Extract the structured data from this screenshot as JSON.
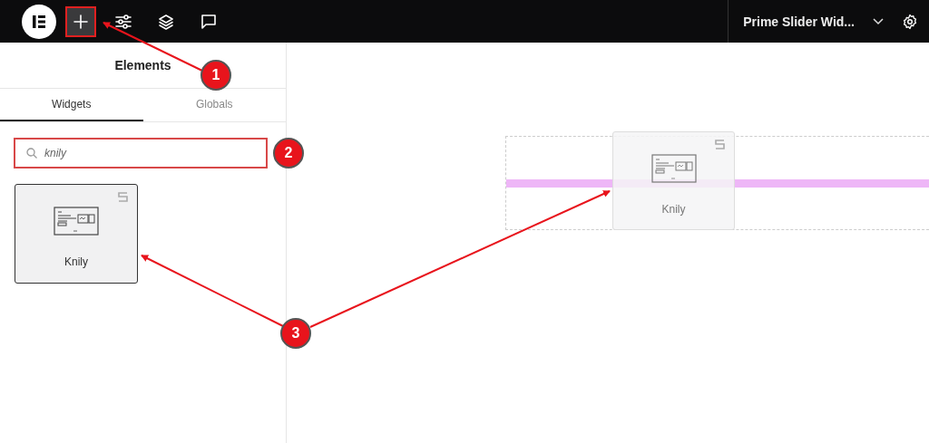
{
  "topbar": {
    "document_title": "Prime Slider Wid...",
    "tools": [
      {
        "kind": "add",
        "selected": true
      },
      {
        "kind": "sliders",
        "selected": false
      },
      {
        "kind": "layers",
        "selected": false
      },
      {
        "kind": "comment",
        "selected": false
      }
    ]
  },
  "sidebar": {
    "title": "Elements",
    "tabs": [
      {
        "label": "Widgets",
        "selected": true
      },
      {
        "label": "Globals",
        "selected": false
      }
    ],
    "search": {
      "value": "knily"
    },
    "widgets": [
      {
        "label": "Knily"
      }
    ]
  },
  "canvas": {
    "dragged_widget": {
      "label": "Knily"
    }
  },
  "annotations": [
    {
      "label": "1"
    },
    {
      "label": "2"
    },
    {
      "label": "3"
    }
  ]
}
